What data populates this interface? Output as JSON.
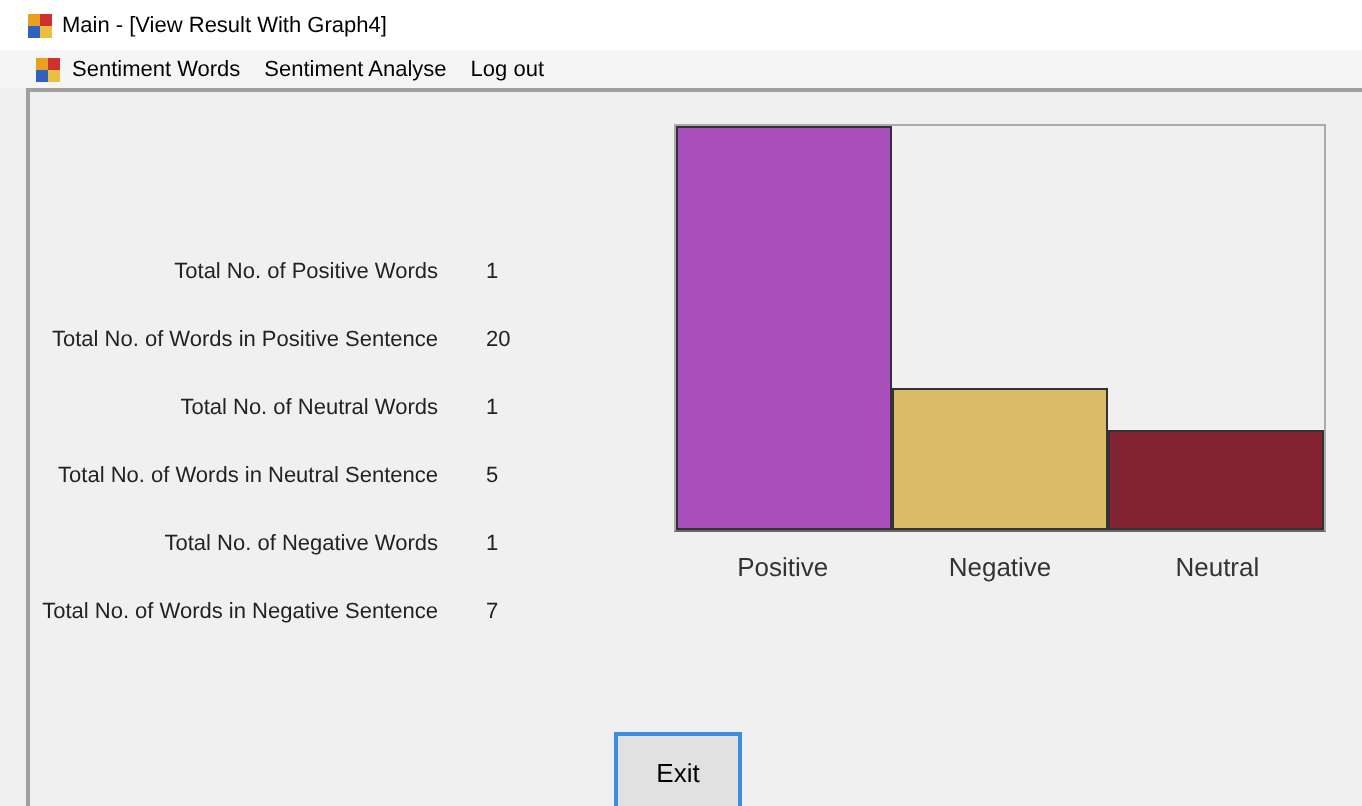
{
  "window": {
    "title": "Main - [View Result With Graph4]"
  },
  "menu": [
    "Sentiment Words",
    "Sentiment Analyse",
    "Log out"
  ],
  "stats": [
    {
      "label": "Total No. of Positive Words",
      "value": "1"
    },
    {
      "label": "Total No. of Words in Positive Sentence",
      "value": "20"
    },
    {
      "label": "Total No. of Neutral Words",
      "value": "1"
    },
    {
      "label": "Total No. of Words in Neutral Sentence",
      "value": "5"
    },
    {
      "label": "Total No. of Negative Words",
      "value": "1"
    },
    {
      "label": "Total No. of Words in Negative Sentence",
      "value": "7"
    }
  ],
  "bars": [
    {
      "label": "Positive",
      "color": "#aa4fbb"
    },
    {
      "label": "Negative",
      "color": "#dabb66"
    },
    {
      "label": "Neutral",
      "color": "#832232"
    }
  ],
  "exit_button": "Exit"
}
